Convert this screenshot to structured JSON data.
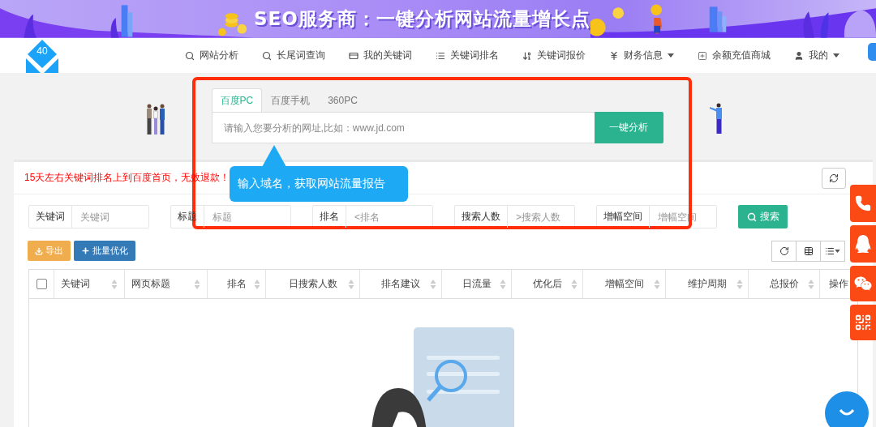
{
  "banner": {
    "title": "SEO服务商：一键分析网站流量增长点"
  },
  "nav": {
    "logo": "40",
    "items": [
      {
        "label": "网站分析",
        "kind": "search",
        "dropdown": false
      },
      {
        "label": "长尾词查询",
        "kind": "search",
        "dropdown": false
      },
      {
        "label": "我的关键词",
        "kind": "card",
        "dropdown": false
      },
      {
        "label": "关键词排名",
        "kind": "list",
        "dropdown": false
      },
      {
        "label": "关键词报价",
        "kind": "sort",
        "dropdown": false
      },
      {
        "label": "财务信息",
        "kind": "yen",
        "dropdown": true
      },
      {
        "label": "余额充值商城",
        "kind": "plus",
        "dropdown": false
      },
      {
        "label": "我的",
        "kind": "user",
        "dropdown": true
      }
    ]
  },
  "hero": {
    "tabs": [
      {
        "label": "百度PC",
        "selected": true
      },
      {
        "label": "百度手机",
        "selected": false
      },
      {
        "label": "360PC",
        "selected": false
      }
    ],
    "placeholder": "请输入您要分析的网址,比如：www.jd.com",
    "button": "一键分析",
    "tooltip": "输入域名，获取网站流量报告"
  },
  "notice": "15天左右关键词排名上到百度首页，无效退款！",
  "filters": [
    {
      "label": "关键词",
      "placeholder": "关键词"
    },
    {
      "label": "标题",
      "placeholder": "标题"
    },
    {
      "label": "排名",
      "placeholder": "<排名"
    },
    {
      "label": "搜索人数",
      "placeholder": ">搜索人数"
    },
    {
      "label": "增幅空间",
      "placeholder": "增幅空间"
    }
  ],
  "search_button": "搜索",
  "actions": [
    {
      "label": "导出",
      "kind": "export"
    },
    {
      "label": "批量优化",
      "kind": "add"
    }
  ],
  "table": {
    "select_all": {
      "checked": false
    },
    "columns": [
      {
        "label": "关键词",
        "sortable": true
      },
      {
        "label": "网页标题",
        "sortable": true
      },
      {
        "label": "排名",
        "sortable": true
      },
      {
        "label": "日搜索人数",
        "sortable": true
      },
      {
        "label": "排名建议",
        "sortable": true
      },
      {
        "label": "日流量",
        "sortable": true
      },
      {
        "label": "优化后",
        "sortable": true
      },
      {
        "label": "增幅空间",
        "sortable": true
      },
      {
        "label": "维护周期",
        "sortable": true
      },
      {
        "label": "总报价",
        "sortable": true
      },
      {
        "label": "操作",
        "sortable": false
      }
    ]
  }
}
